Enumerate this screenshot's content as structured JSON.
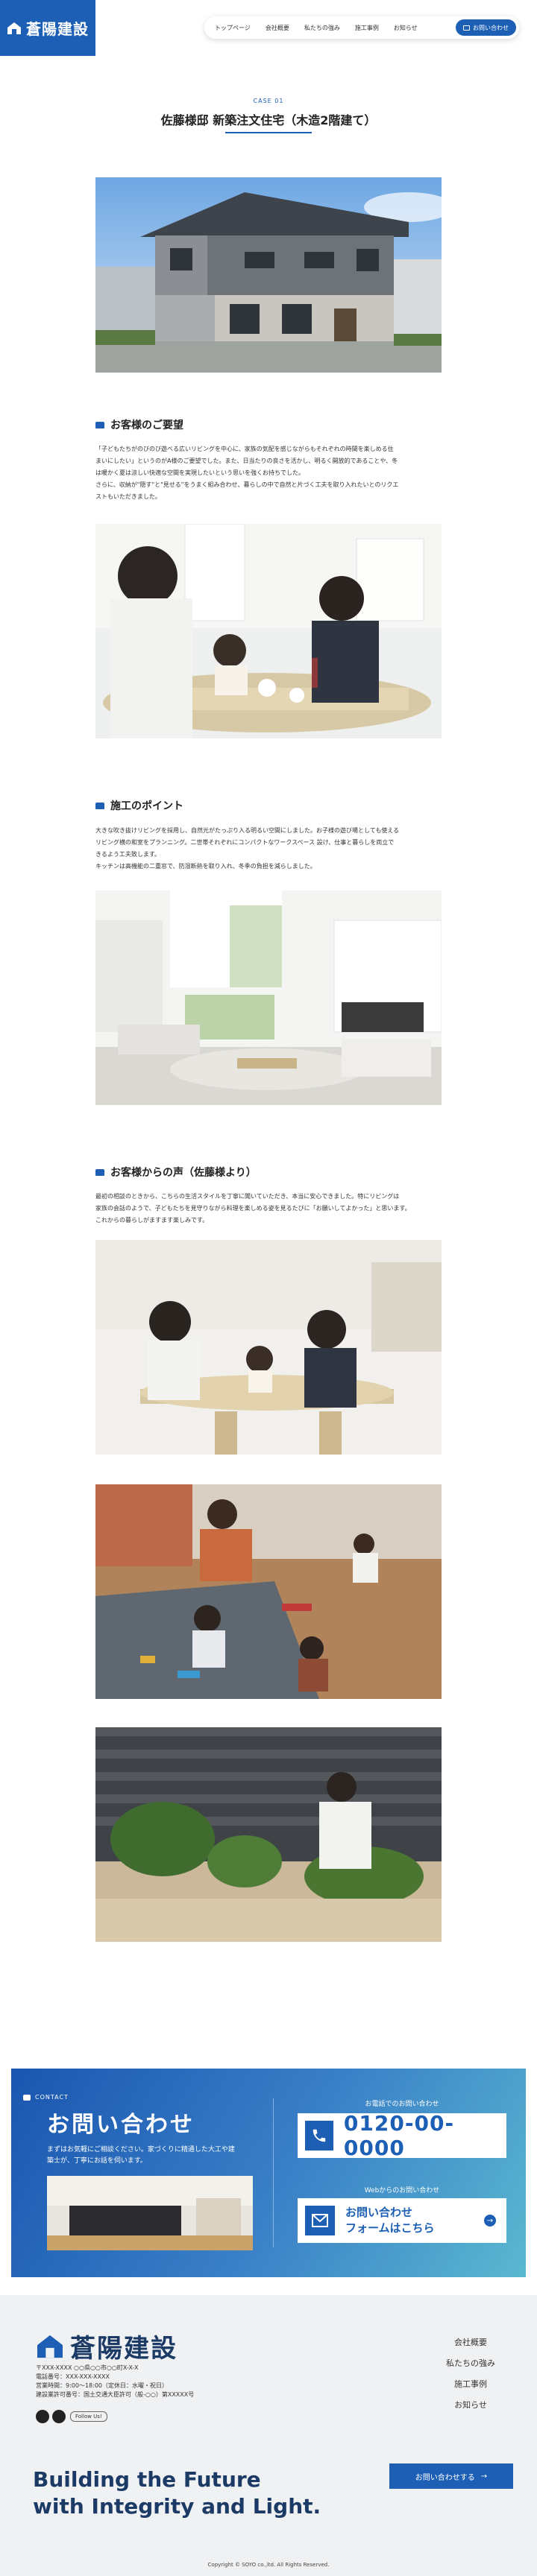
{
  "header": {
    "logo": "蒼陽建設",
    "nav": [
      "トップページ",
      "会社概要",
      "私たちの強み",
      "施工事例",
      "お知らせ"
    ],
    "cta": "お問い合わせ"
  },
  "case": {
    "label": "CASE 01",
    "title": "佐藤様邸 新築注文住宅（木造2階建て）"
  },
  "request": {
    "heading": "お客様のご要望",
    "lines": [
      "「子どもたちがのびのび遊べる広いリビングを中心に、家族の気配を感じながらもそれぞれの時間を楽しめる住",
      "まいにしたい」というのがA様のご要望でした。また、日当たりの良さを活かし、明るく開放的であることや、冬",
      "は暖かく夏は涼しい快適な空間を実現したいという思いを強くお持ちでした。",
      "さらに、収納が\"隠す\"と\"見せる\"をうまく組み合わせ、暮らしの中で自然と片づく工夫を取り入れたいとのリクエ",
      "ストもいただきました。"
    ]
  },
  "points": {
    "heading": "施工のポイント",
    "lines": [
      "大きな吹き抜けリビングを採用し、自然光がたっぷり入る明るい空間にしました。お子様の遊び場としても使える",
      "リビング横の和室をプランニング。二世帯それぞれにコンパクトなワークスペース 設け、仕事と暮らしを両立で",
      "きるよう工夫致します。",
      "キッチンは高機能の二重窓で、防湿断熱を取り入れ、冬季の負担を減らしました。"
    ]
  },
  "voice": {
    "heading": "お客様からの声（佐藤様より）",
    "lines": [
      "最初の相談のときから、こちらの生活スタイルを丁寧に聞いていただき、本当に安心できました。特にリビングは",
      "家族の会話のようで、子どもたちを見守りながら料理を楽しめる姿を見るたびに「お願いしてよかった」と思います。",
      "これからの暮らしがますます楽しみです。"
    ]
  },
  "contact": {
    "label": "CONTACT",
    "title": "お問い合わせ",
    "desc_lines": [
      "まずはお気軽にご相談ください。家づくりに精通した大工や建",
      "築士が、丁寧にお話を伺います。"
    ],
    "tel_label": "お電話でのお問い合わせ",
    "tel": "0120-00-0000",
    "web_label": "Webからのお問い合わせ",
    "web_lines": [
      "お問い合わせ",
      "フォームはこちら"
    ]
  },
  "footer": {
    "logo": "蒼陽建設",
    "address_lines": [
      "〒XXX-XXXX ○○県○○市○○町X-X-X",
      "電話番号：XXX-XXX-XXXX",
      "営業時間：9:00〜18:00（定休日：水曜・祝日）",
      "建設業許可番号：国土交通大臣許可（般-○○）第XXXXX号"
    ],
    "follow": "Follow Us!",
    "links": [
      "会社概要",
      "私たちの強み",
      "施工事例",
      "お知らせ"
    ],
    "slogan_lines": [
      "Building the Future",
      "with Integrity and Light."
    ],
    "cta": "お問い合わせする",
    "copyright": "Copyright © SOYO co.,ltd. All Rights Reserved."
  },
  "colors": {
    "brand": "#1c5fb5",
    "navy": "#1b3a66",
    "footer_bg": "#f0f1f3"
  },
  "icons": [
    "house-logo-icon",
    "mail-icon",
    "phone-icon",
    "arrow-right-icon",
    "youtube-icon",
    "instagram-icon"
  ]
}
